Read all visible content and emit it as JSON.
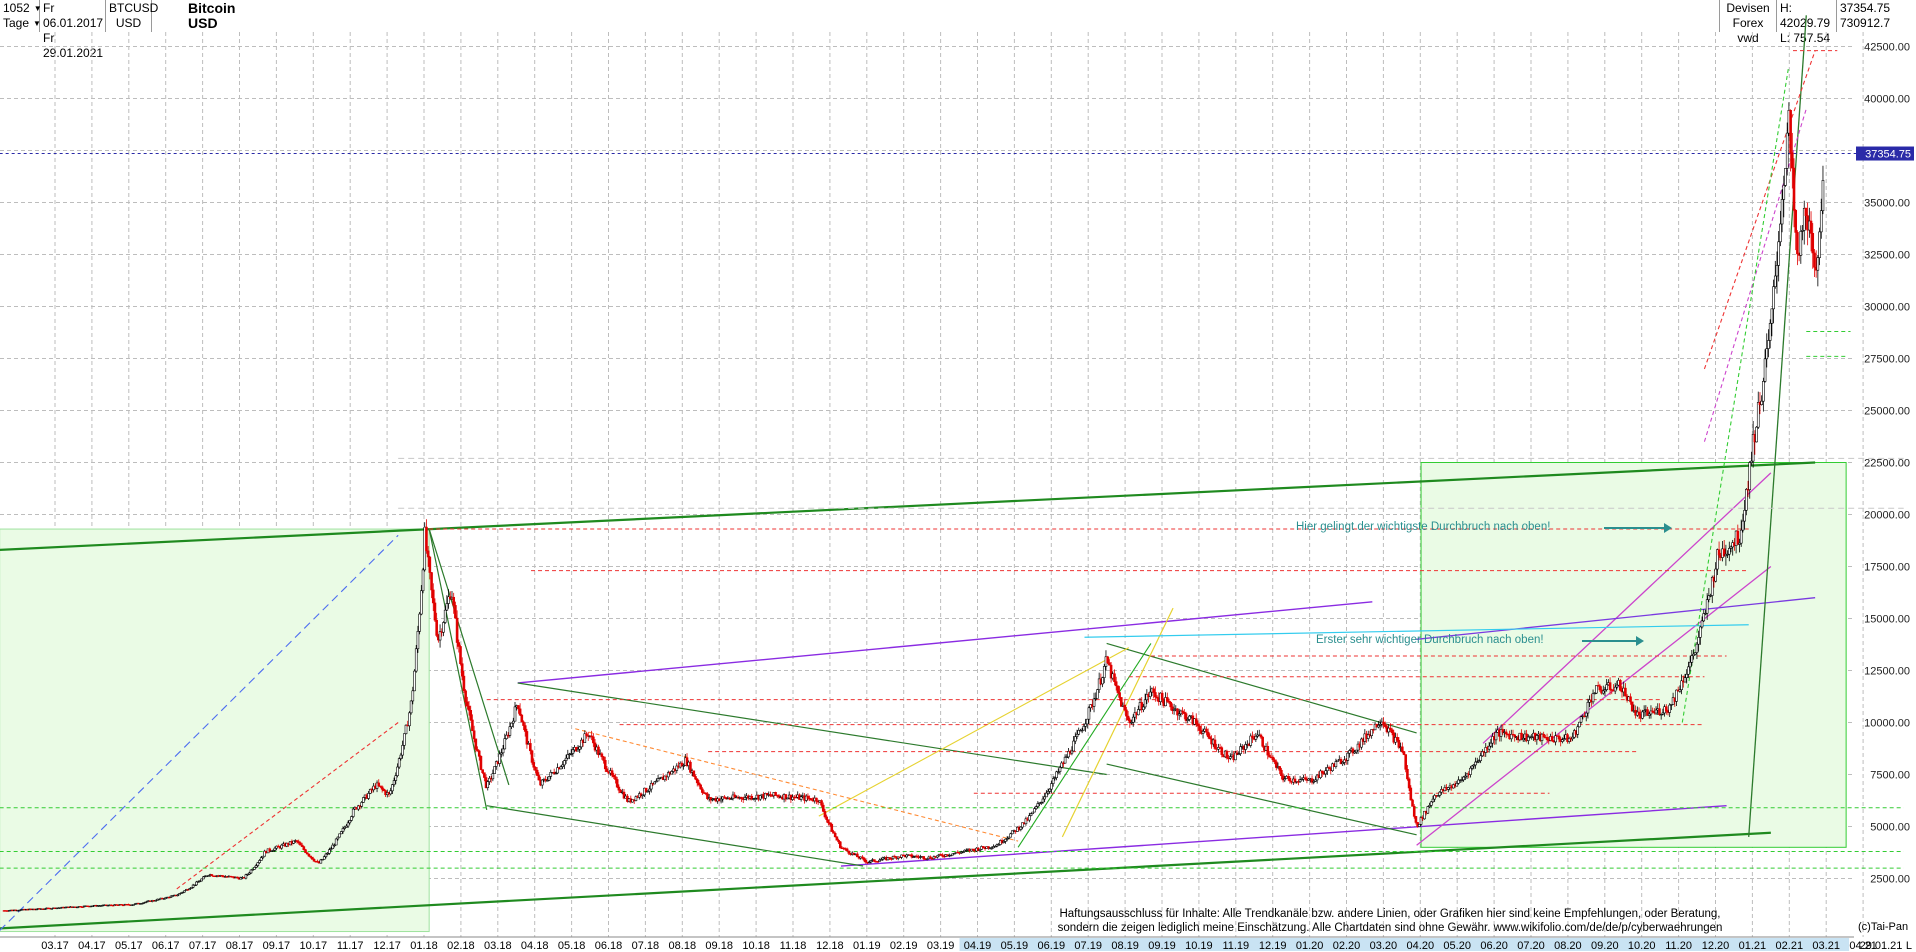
{
  "header": {
    "period_count": "1052",
    "timeframe": "Tage",
    "date_from": "Fr 06.01.2017",
    "date_to": "Fr 29.01.2021",
    "symbol": "BTCUSD",
    "currency": "USD",
    "instrument_title": "Bitcoin USD",
    "market_line1": "Devisen",
    "market_line2": "Forex vwd",
    "high_label": "H: 42029.79",
    "low_label": "L: 757.54",
    "last_price": "37354.75",
    "volume": "730912.7"
  },
  "chart_data": {
    "type": "candlestick",
    "title": "Bitcoin USD",
    "y_ticks": [
      "2500.00",
      "5000.00",
      "7500.00",
      "10000.00",
      "12500.00",
      "15000.00",
      "17500.00",
      "20000.00",
      "22500.00",
      "25000.00",
      "27500.00",
      "30000.00",
      "32500.00",
      "35000.00",
      "37500.00",
      "40000.00",
      "42500.00"
    ],
    "ylim": [
      0,
      44000
    ],
    "x_ticks": [
      "03.17",
      "04.17",
      "05.17",
      "06.17",
      "07.17",
      "08.17",
      "09.17",
      "10.17",
      "11.17",
      "12.17",
      "01.18",
      "02.18",
      "03.18",
      "04.18",
      "05.18",
      "06.18",
      "07.18",
      "08.18",
      "09.18",
      "10.18",
      "11.18",
      "12.18",
      "01.19",
      "02.19",
      "03.19",
      "04.19",
      "05.19",
      "06.19",
      "07.19",
      "08.19",
      "09.19",
      "10.19",
      "11.19",
      "12.19",
      "01.20",
      "02.20",
      "03.20",
      "04.20",
      "05.20",
      "06.20",
      "07.20",
      "08.20",
      "09.20",
      "10.20",
      "11.20",
      "12.20",
      "01.21",
      "02.21",
      "03.21",
      "04.21"
    ],
    "x_end_label": "29.01.21",
    "x_end_suffix": "L",
    "current_price": 37354.75,
    "current_price_label": "37354.75",
    "price_path": [
      [
        2017.01,
        960
      ],
      [
        2017.1,
        1050
      ],
      [
        2017.2,
        1180
      ],
      [
        2017.3,
        1250
      ],
      [
        2017.4,
        1700
      ],
      [
        2017.47,
        2700
      ],
      [
        2017.55,
        2500
      ],
      [
        2017.6,
        3800
      ],
      [
        2017.67,
        4300
      ],
      [
        2017.72,
        3200
      ],
      [
        2017.8,
        5800
      ],
      [
        2017.85,
        7000
      ],
      [
        2017.88,
        6500
      ],
      [
        2017.93,
        11000
      ],
      [
        2017.96,
        19000
      ],
      [
        2017.99,
        14000
      ],
      [
        2018.02,
        16500
      ],
      [
        2018.05,
        11500
      ],
      [
        2018.1,
        6900
      ],
      [
        2018.17,
        11000
      ],
      [
        2018.22,
        7000
      ],
      [
        2018.33,
        9500
      ],
      [
        2018.42,
        6200
      ],
      [
        2018.55,
        8200
      ],
      [
        2018.6,
        6300
      ],
      [
        2018.75,
        6500
      ],
      [
        2018.85,
        6300
      ],
      [
        2018.9,
        4000
      ],
      [
        2018.96,
        3300
      ],
      [
        2019.04,
        3600
      ],
      [
        2019.1,
        3500
      ],
      [
        2019.25,
        4100
      ],
      [
        2019.32,
        5300
      ],
      [
        2019.4,
        8000
      ],
      [
        2019.46,
        10500
      ],
      [
        2019.5,
        13000
      ],
      [
        2019.55,
        10000
      ],
      [
        2019.6,
        11500
      ],
      [
        2019.7,
        10000
      ],
      [
        2019.78,
        8200
      ],
      [
        2019.84,
        9500
      ],
      [
        2019.9,
        7300
      ],
      [
        2019.96,
        7200
      ],
      [
        2020.05,
        8500
      ],
      [
        2020.12,
        10200
      ],
      [
        2020.17,
        8600
      ],
      [
        2020.2,
        5000
      ],
      [
        2020.24,
        6500
      ],
      [
        2020.3,
        7200
      ],
      [
        2020.38,
        9500
      ],
      [
        2020.45,
        9300
      ],
      [
        2020.55,
        9200
      ],
      [
        2020.6,
        11500
      ],
      [
        2020.66,
        11800
      ],
      [
        2020.7,
        10300
      ],
      [
        2020.77,
        10700
      ],
      [
        2020.83,
        13500
      ],
      [
        2020.88,
        18000
      ],
      [
        2020.93,
        19000
      ],
      [
        2020.96,
        23500
      ],
      [
        2021.0,
        29000
      ],
      [
        2021.02,
        34000
      ],
      [
        2021.04,
        39000
      ],
      [
        2021.06,
        32000
      ],
      [
        2021.08,
        35000
      ],
      [
        2021.1,
        31000
      ],
      [
        2021.12,
        37354.75
      ]
    ],
    "annotations": [
      "Hier gelingt der wichtigste Durchbruch nach oben!",
      "Erster sehr wichtiger Durchbruch nach oben!"
    ]
  },
  "disclaimer": {
    "line1": "Haftungsausschluss für Inhalte: Alle Trendkanäle bzw. andere Linien, oder Grafiken hier sind keine Empfehlungen, oder Beratung,",
    "line2": "sondern die zeigen lediglich meine Einschätzung. Alle Chartdaten sind ohne Gewähr. www.wikifolio.com/de/de/p/cyberwaehrungen"
  },
  "copyright": "(c)Tai-Pan",
  "colors": {
    "up": "#000000",
    "down": "#e00000",
    "grid": "#bdbdbd",
    "trend_green": "#1f8a1f",
    "trend_purple": "#8a2be2",
    "price_line": "#2a2aa8",
    "annotation": "#2b8f8f",
    "box_fill": "#eafbe5"
  }
}
